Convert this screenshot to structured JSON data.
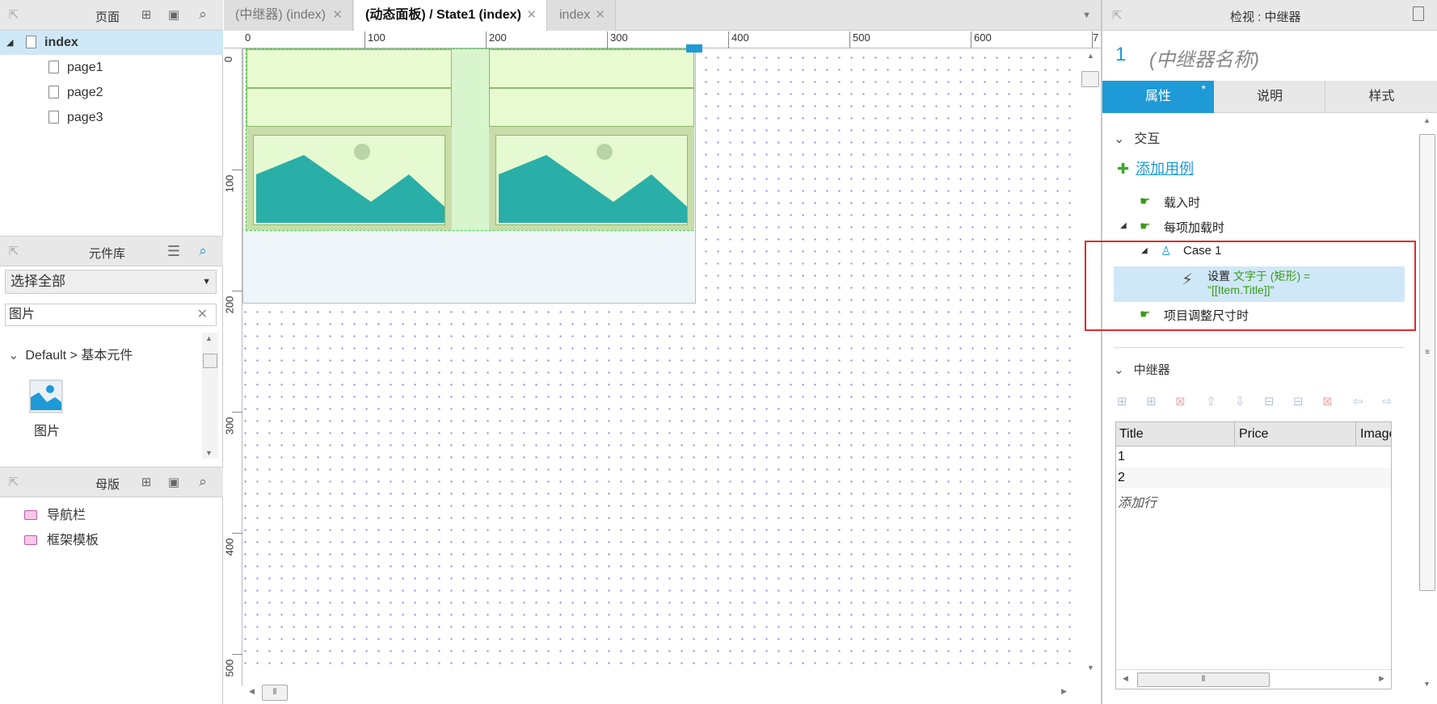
{
  "left": {
    "pages": {
      "title": "页面",
      "root": "index",
      "children": [
        "page1",
        "page2",
        "page3"
      ]
    },
    "library": {
      "title": "元件库",
      "select_value": "选择全部",
      "search_value": "图片",
      "group_label": "Default > 基本元件",
      "item_label": "图片"
    },
    "masters": {
      "title": "母版",
      "items": [
        "导航栏",
        "框架模板"
      ]
    }
  },
  "tabs": [
    {
      "label": "(中继器) (index)",
      "active": false
    },
    {
      "label": "(动态面板) / State1 (index)",
      "active": true
    },
    {
      "label": "index",
      "active": false
    }
  ],
  "ruler": {
    "h": [
      "0",
      "100",
      "200",
      "300",
      "400",
      "500",
      "600",
      "7"
    ],
    "v": [
      "0",
      "100",
      "200",
      "300",
      "400",
      "500"
    ]
  },
  "inspector": {
    "header": "检视 : 中继器",
    "id": "1",
    "name_placeholder": "(中继器名称)",
    "tabs": [
      "属性",
      "说明",
      "样式"
    ],
    "tab_star": "*",
    "interaction_title": "交互",
    "add_case": "添加用例",
    "events": {
      "on_load": "载入时",
      "on_item_load": "每项加载时",
      "case": "Case 1",
      "action_verb": "设置",
      "action_detail_1": "文字于 (矩形) =",
      "action_detail_2": "\"[[Item.Title]]\"",
      "on_item_resize": "项目调整尺寸时"
    },
    "repeater_title": "中继器",
    "dataset": {
      "columns": [
        "Title",
        "Price",
        "Image"
      ],
      "rows": [
        "1",
        "2"
      ],
      "add_row": "添加行"
    }
  },
  "colors": {
    "accent": "#1e9ad6",
    "highlight_red": "#e0282e",
    "selected_row": "#cfe8f7",
    "action_green": "#3a9a1a"
  }
}
